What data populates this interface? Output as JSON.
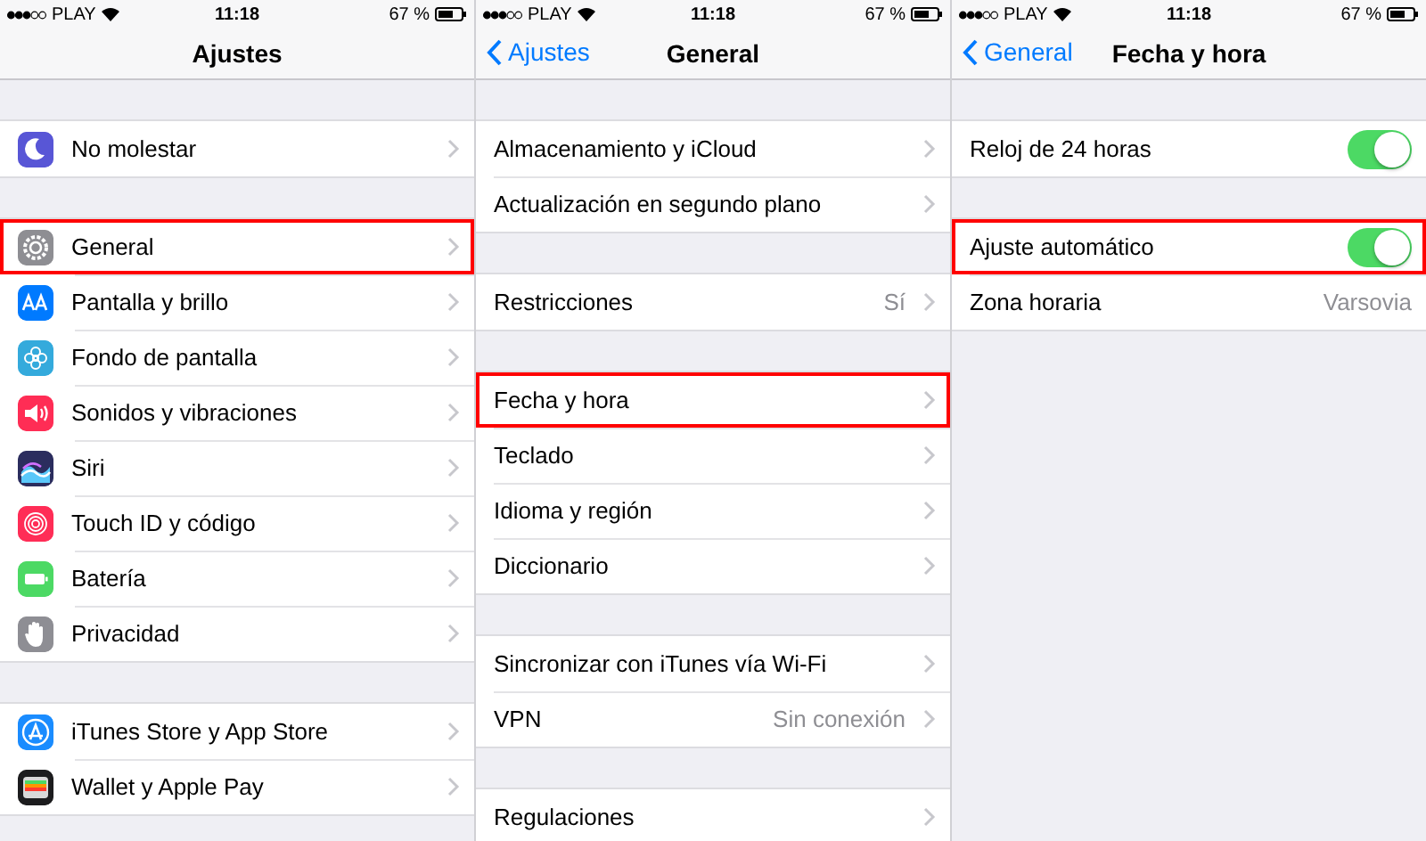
{
  "screens": [
    {
      "status": {
        "carrier": "PLAY",
        "time": "11:18",
        "battery": "67 %"
      },
      "nav": {
        "title": "Ajustes"
      },
      "groups": [
        {
          "rows": [
            {
              "kind": "link",
              "color": "#5856d6",
              "label": "No molestar",
              "highlighted": false
            }
          ]
        },
        {
          "rows": [
            {
              "kind": "link",
              "color": "#8e8e93",
              "label": "General",
              "highlighted": true
            },
            {
              "kind": "link",
              "color": "#007aff",
              "label": "Pantalla y brillo",
              "highlighted": false
            },
            {
              "kind": "link",
              "color": "#34aadc",
              "label": "Fondo de pantalla",
              "highlighted": false
            },
            {
              "kind": "link",
              "color": "#ff2d55",
              "label": "Sonidos y vibraciones",
              "highlighted": false
            },
            {
              "kind": "link",
              "color": "#2b2d5e",
              "label": "Siri",
              "highlighted": false
            },
            {
              "kind": "link",
              "color": "#ff2d56",
              "label": "Touch ID y código",
              "highlighted": false
            },
            {
              "kind": "link",
              "color": "#4cd964",
              "label": "Batería",
              "highlighted": false
            },
            {
              "kind": "link",
              "color": "#8e8e94",
              "label": "Privacidad",
              "highlighted": false
            }
          ]
        },
        {
          "rows": [
            {
              "kind": "link",
              "color": "#1a8cff",
              "label": "iTunes Store y App Store",
              "highlighted": false
            },
            {
              "kind": "link",
              "color": "#1c1c1e",
              "label": "Wallet y Apple Pay",
              "highlighted": false
            }
          ]
        }
      ]
    },
    {
      "status": {
        "carrier": "PLAY",
        "time": "11:18",
        "battery": "67 %"
      },
      "nav": {
        "back": "Ajustes",
        "title": "General"
      },
      "groups": [
        {
          "rows": [
            {
              "kind": "link",
              "label": "Almacenamiento y iCloud",
              "highlighted": false
            },
            {
              "kind": "link",
              "label": "Actualización en segundo plano",
              "highlighted": false
            }
          ]
        },
        {
          "rows": [
            {
              "kind": "link",
              "label": "Restricciones",
              "value": "Sí",
              "highlighted": false
            }
          ]
        },
        {
          "rows": [
            {
              "kind": "link",
              "label": "Fecha y hora",
              "highlighted": true
            },
            {
              "kind": "link",
              "label": "Teclado",
              "highlighted": false
            },
            {
              "kind": "link",
              "label": "Idioma y región",
              "highlighted": false
            },
            {
              "kind": "link",
              "label": "Diccionario",
              "highlighted": false
            }
          ]
        },
        {
          "rows": [
            {
              "kind": "link",
              "label": "Sincronizar con iTunes vía Wi-Fi",
              "highlighted": false
            },
            {
              "kind": "link",
              "label": "VPN",
              "value": "Sin conexión",
              "highlighted": false
            }
          ]
        },
        {
          "rows": [
            {
              "kind": "link",
              "label": "Regulaciones",
              "highlighted": false
            }
          ]
        }
      ]
    },
    {
      "status": {
        "carrier": "PLAY",
        "time": "11:18",
        "battery": "67 %"
      },
      "nav": {
        "back": "General",
        "title": "Fecha y hora"
      },
      "groups": [
        {
          "rows": [
            {
              "kind": "toggle",
              "label": "Reloj de 24 horas",
              "on": true,
              "highlighted": false
            }
          ]
        },
        {
          "rows": [
            {
              "kind": "toggle",
              "label": "Ajuste automático",
              "on": true,
              "highlighted": true
            },
            {
              "kind": "detail",
              "label": "Zona horaria",
              "value": "Varsovia",
              "highlighted": false
            }
          ]
        }
      ]
    }
  ]
}
